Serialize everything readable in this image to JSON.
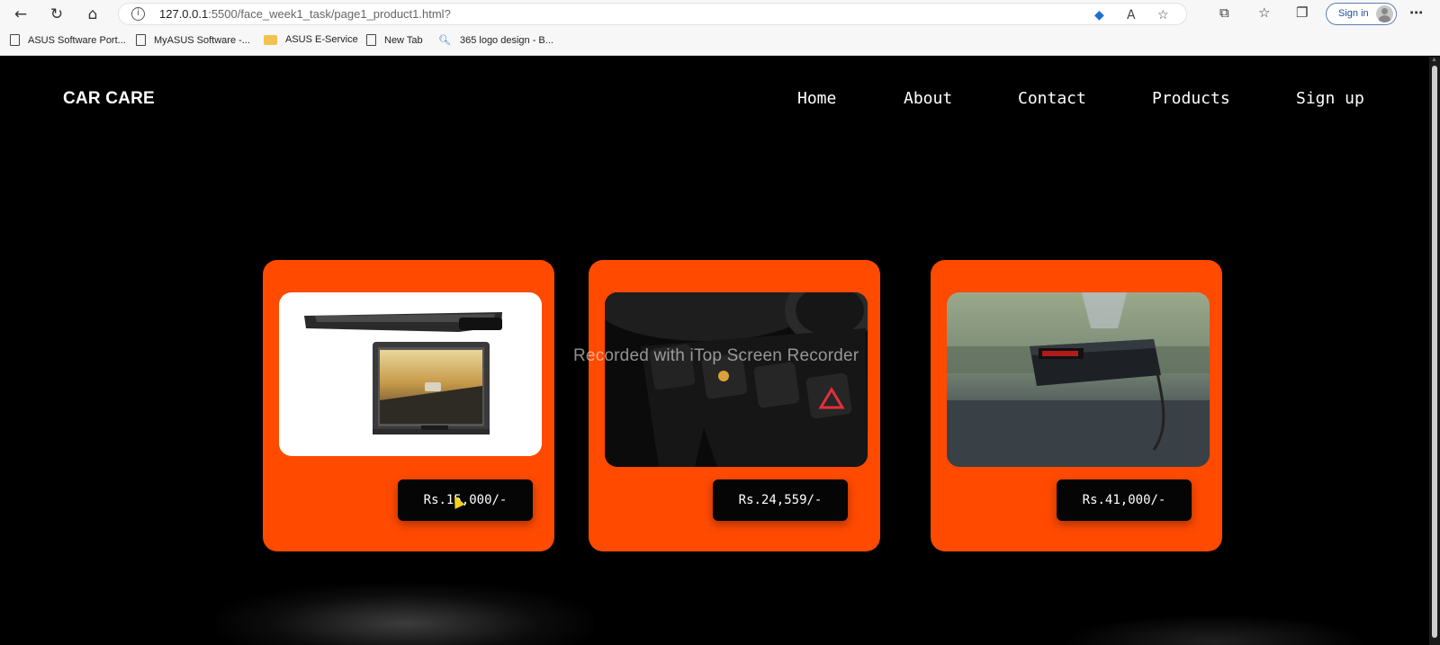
{
  "browser": {
    "url_host": "127.0.0.1",
    "url_rest": ":5500/face_week1_task/page1_product1.html?",
    "sign_in_label": "Sign in",
    "bookmarks": [
      {
        "label": "ASUS Software Port...",
        "icon": "page-icon"
      },
      {
        "label": "MyASUS Software -...",
        "icon": "page-icon"
      },
      {
        "label": "ASUS E-Service",
        "icon": "folder-icon"
      },
      {
        "label": "New Tab",
        "icon": "page-icon"
      },
      {
        "label": "365 logo design - B...",
        "icon": "search-icon"
      }
    ]
  },
  "site": {
    "brand": "CAR CARE",
    "nav": [
      {
        "label": "Home"
      },
      {
        "label": "About"
      },
      {
        "label": "Contact"
      },
      {
        "label": "Products"
      },
      {
        "label": "Sign up"
      }
    ]
  },
  "products": [
    {
      "price": "Rs.15,000/-",
      "image": "roof-mounted-car-monitor"
    },
    {
      "price": "Rs.24,559/-",
      "image": "car-dashboard-buttons"
    },
    {
      "price": "Rs.41,000/-",
      "image": "radar-detector-windshield"
    }
  ],
  "overlay": {
    "watermark": "Recorded with iTop Screen Recorder"
  },
  "colors": {
    "card_orange": "#ff4a00",
    "page_bg": "#000000",
    "button_bg": "#050505"
  }
}
